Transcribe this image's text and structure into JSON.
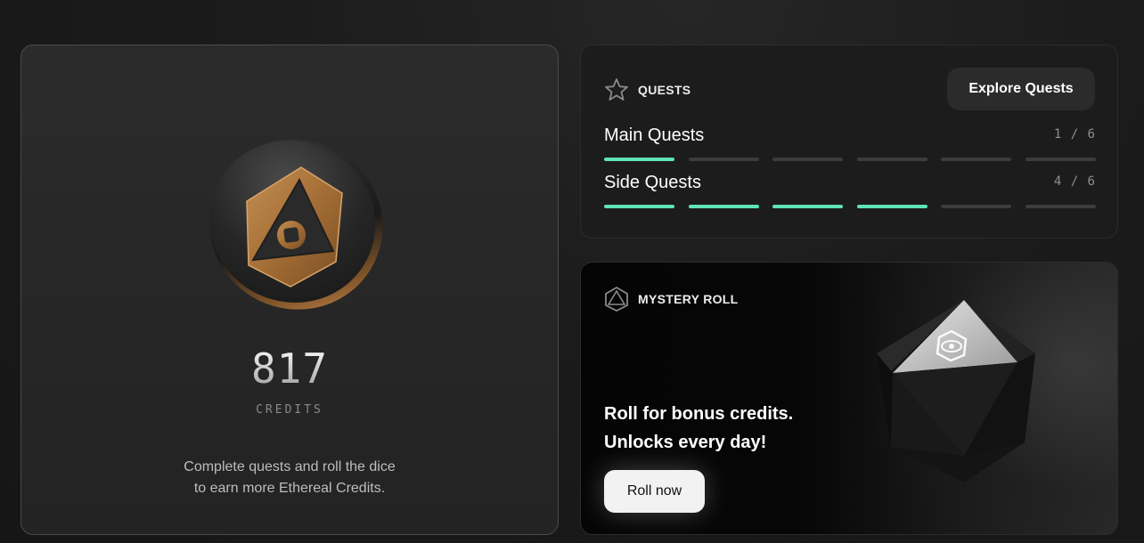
{
  "credits": {
    "value": "817",
    "label": "CREDITS",
    "description_line1": "Complete quests and roll the dice",
    "description_line2": "to earn more Ethereal Credits."
  },
  "quests": {
    "title": "QUESTS",
    "icon": "star-icon",
    "explore_label": "Explore Quests",
    "rows": [
      {
        "name": "Main Quests",
        "count": "1 / 6",
        "completed": 1,
        "total": 6
      },
      {
        "name": "Side Quests",
        "count": "4 / 6",
        "completed": 4,
        "total": 6
      }
    ]
  },
  "mystery": {
    "title": "MYSTERY ROLL",
    "icon": "octahedron-icon",
    "line1": "Roll for bonus credits.",
    "line2": "Unlocks every day!",
    "button_label": "Roll now"
  },
  "colors": {
    "progress_done": "#5fe3b5",
    "progress_empty": "#3c3c3c",
    "coin_gold": "#b07a3e"
  }
}
